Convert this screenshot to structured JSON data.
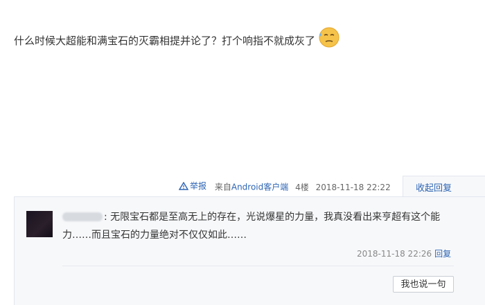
{
  "post": {
    "text": "什么时候大超能和满宝石的灭霸相提并论了？打个响指不就成灰了",
    "emoji_icon": "sweat-emoji-icon"
  },
  "meta": {
    "report_label": "举报",
    "source_label": "来自Android客户端",
    "floor": "4楼",
    "datetime": "2018-11-18 22:22",
    "collapse_label": "收起回复"
  },
  "reply": {
    "username": "（模糊）",
    "text_prefix": ": ",
    "text": "无限宝石都是至高无上的存在，光说爆星的力量，我真没看出来亨超有这个能力……而且宝石的力量绝对不仅仅如此……",
    "datetime": "2018-11-18 22:26",
    "reply_label": "回复"
  },
  "say_button_label": "我也说一句",
  "colors": {
    "link": "#2d64b3",
    "panel_bg": "#f7f8fa",
    "border": "#e1e6ee"
  }
}
